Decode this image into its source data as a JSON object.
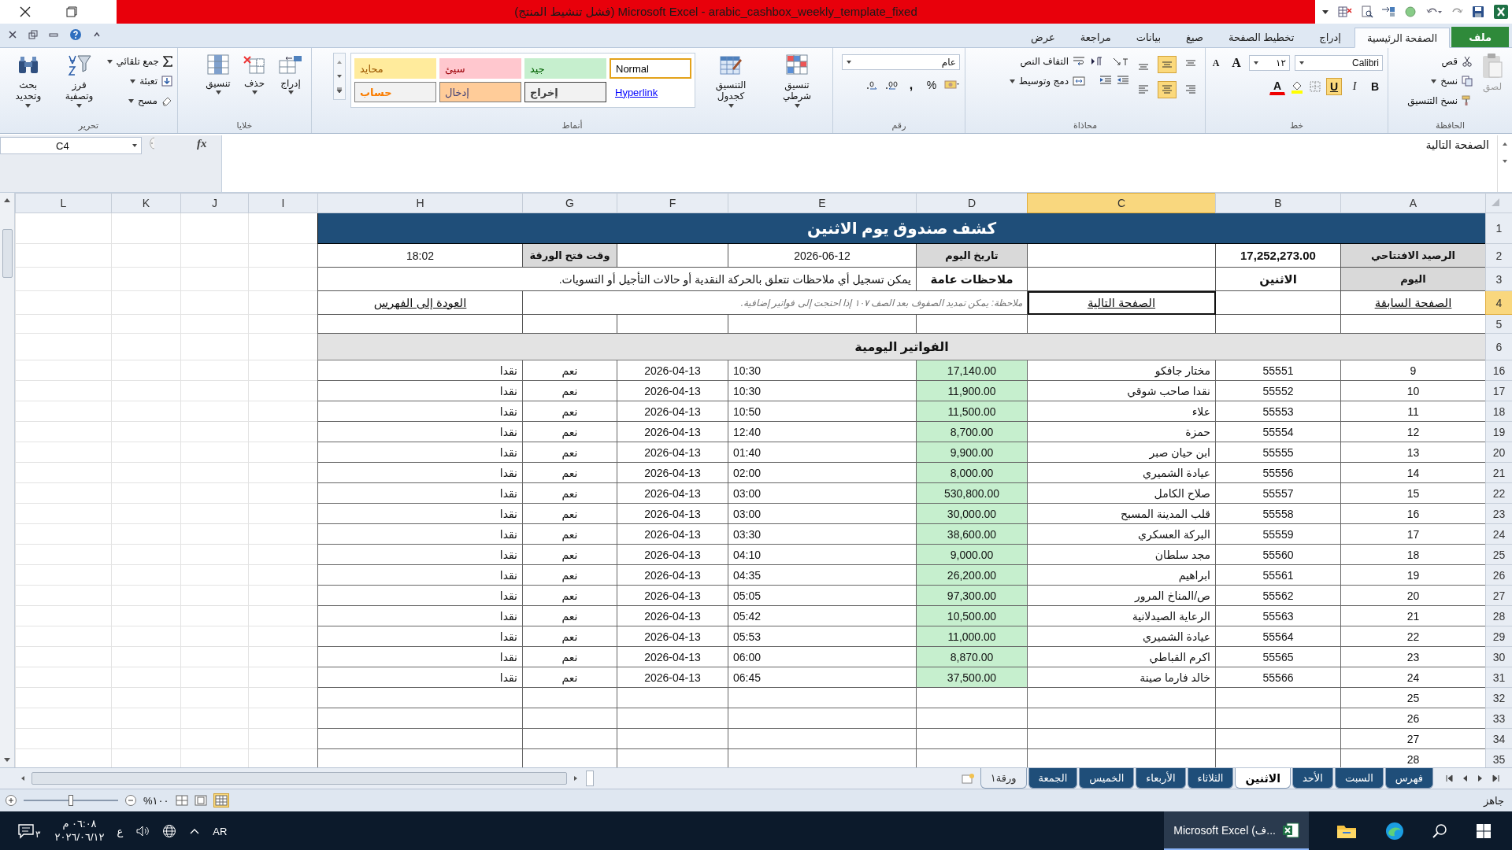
{
  "title_bar": {
    "title": "(فشل تنشيط المنتج) Microsoft Excel - arabic_cashbox_weekly_template_fixed"
  },
  "ribbon_tabs": [
    {
      "label": "ملف",
      "kind": "file",
      "selected": false
    },
    {
      "label": "الصفحة الرئيسية",
      "kind": "tab",
      "selected": true
    },
    {
      "label": "إدراج",
      "kind": "tab",
      "selected": false
    },
    {
      "label": "تخطيط الصفحة",
      "kind": "tab",
      "selected": false
    },
    {
      "label": "صيغ",
      "kind": "tab",
      "selected": false
    },
    {
      "label": "بيانات",
      "kind": "tab",
      "selected": false
    },
    {
      "label": "مراجعة",
      "kind": "tab",
      "selected": false
    },
    {
      "label": "عرض",
      "kind": "tab",
      "selected": false
    }
  ],
  "clipboard": {
    "label": "الحافظة",
    "paste": "لصق",
    "paste_disabled": true,
    "cut": "قص",
    "copy": "نسخ",
    "format_painter": "نسخ التنسيق"
  },
  "font": {
    "label": "خط",
    "family": "Calibri",
    "size": "١٢",
    "grow": "A",
    "shrink": "A",
    "font_color": "A",
    "buttons": [
      {
        "label": "B",
        "kind": "bold",
        "on": false
      },
      {
        "label": "I",
        "kind": "italic",
        "on": false
      },
      {
        "label": "U",
        "kind": "underline",
        "on": true
      }
    ]
  },
  "alignment": {
    "label": "محاذاة",
    "wrap_text": "التفاف النص",
    "merge_center": "دمج وتوسيط",
    "vertical": [
      {
        "kind": "top",
        "selected": false
      },
      {
        "kind": "middle",
        "selected": true
      },
      {
        "kind": "bottom",
        "selected": false
      }
    ],
    "horizontal": [
      {
        "kind": "right",
        "selected": false
      },
      {
        "kind": "center",
        "selected": true
      },
      {
        "kind": "left",
        "selected": false
      }
    ]
  },
  "number": {
    "label": "رقم",
    "format": "عام",
    "percent": "%",
    "comma": ","
  },
  "styles": {
    "label": "أنماط",
    "conditional": "تنسيق شرطي",
    "as_table": "التنسيق كجدول",
    "cell_styles": [
      {
        "label": "Normal",
        "kind": "normal",
        "selected": true
      },
      {
        "label": "جيد",
        "kind": "good",
        "selected": false
      },
      {
        "label": "سيئ",
        "kind": "bad",
        "selected": false
      },
      {
        "label": "محايد",
        "kind": "neutral",
        "selected": false
      },
      {
        "label": "Hyperlink",
        "kind": "hyperlink",
        "selected": false
      },
      {
        "label": "إخراج",
        "kind": "output",
        "selected": false
      },
      {
        "label": "إدخال",
        "kind": "input",
        "selected": false
      },
      {
        "label": "حساب",
        "kind": "calculation",
        "selected": false
      }
    ]
  },
  "cells": {
    "label": "خلايا",
    "insert": "إدراج",
    "delete": "حذف",
    "format": "تنسيق"
  },
  "editing": {
    "label": "تحرير",
    "autosum": "جمع تلقائي",
    "fill": "تعبئة",
    "clear": "مسح",
    "sort": "فرز وتصفية",
    "find": "بحث وتحديد"
  },
  "formula_bar": {
    "name_box": "C4",
    "function_label": "fx",
    "content": "الصفحة التالية"
  },
  "columns": [
    {
      "label": "A",
      "selected": false
    },
    {
      "label": "B",
      "selected": false
    },
    {
      "label": "C",
      "selected": true
    },
    {
      "label": "D",
      "selected": false
    },
    {
      "label": "E",
      "selected": false
    },
    {
      "label": "F",
      "selected": false
    },
    {
      "label": "G",
      "selected": false
    },
    {
      "label": "H",
      "selected": false
    },
    {
      "label": "I",
      "selected": false
    },
    {
      "label": "J",
      "selected": false
    },
    {
      "label": "K",
      "selected": false
    },
    {
      "label": "L",
      "selected": false
    }
  ],
  "rows": [
    {
      "number": "1",
      "kind": "title",
      "selected": false,
      "text": "كشف صندوق يوم الاثنين"
    },
    {
      "number": "2",
      "kind": "form",
      "selected": false,
      "cells": [
        {
          "kind": "label",
          "text": "الرصيد الافتتاحي"
        },
        {
          "kind": "strong",
          "text": "17,252,273.00"
        },
        {
          "kind": "empty"
        },
        {
          "kind": "label",
          "text": "تاريخ اليوم"
        },
        {
          "kind": "value",
          "text": "2026-06-12"
        },
        {
          "kind": "empty"
        },
        {
          "kind": "label",
          "text": "وقت فتح الورقة"
        },
        {
          "kind": "value",
          "text": "18:02"
        }
      ]
    },
    {
      "number": "3",
      "kind": "form",
      "selected": false,
      "cells": [
        {
          "kind": "label",
          "text": "اليوم"
        },
        {
          "kind": "strong",
          "text": "الاثنين"
        },
        {
          "kind": "empty"
        },
        {
          "kind": "strong",
          "text": "ملاحظات عامة"
        },
        {
          "kind": "text",
          "text": "يمكن تسجيل أي ملاحظات تتعلق بالحركة النقدية أو حالات التأجيل أو التسويات."
        }
      ]
    },
    {
      "number": "4",
      "kind": "form",
      "selected": true,
      "cells": [
        {
          "kind": "link",
          "text": "الصفحة السابقة"
        },
        {
          "kind": "empty"
        },
        {
          "kind": "link",
          "text": "الصفحة التالية"
        },
        {
          "kind": "note",
          "text": "ملاحظة: يمكن تمديد الصفوف بعد الصف ١٠٧ إذا احتجت إلى فواتير إضافية."
        },
        {
          "kind": "link",
          "text": "العودة إلى الفهرس"
        }
      ]
    },
    {
      "number": "5",
      "kind": "blank",
      "selected": false
    },
    {
      "number": "6",
      "kind": "section",
      "selected": false,
      "text": "الفواتير اليومية"
    },
    {
      "number": "16",
      "kind": "invoice",
      "selected": false,
      "values": [
        "9",
        "55551",
        "مختار جافكو",
        "17,140.00",
        "10:30",
        "2026-04-13",
        "نعم",
        "نقدا"
      ]
    },
    {
      "number": "17",
      "kind": "invoice",
      "selected": false,
      "values": [
        "10",
        "55552",
        "نقدا صاحب شوقي",
        "11,900.00",
        "10:30",
        "2026-04-13",
        "نعم",
        "نقدا"
      ]
    },
    {
      "number": "18",
      "kind": "invoice",
      "selected": false,
      "values": [
        "11",
        "55553",
        "علاء",
        "11,500.00",
        "10:50",
        "2026-04-13",
        "نعم",
        "نقدا"
      ]
    },
    {
      "number": "19",
      "kind": "invoice",
      "selected": false,
      "values": [
        "12",
        "55554",
        "حمزة",
        "8,700.00",
        "12:40",
        "2026-04-13",
        "نعم",
        "نقدا"
      ]
    },
    {
      "number": "20",
      "kind": "invoice",
      "selected": false,
      "values": [
        "13",
        "55555",
        "ابن حيان صبر",
        "9,900.00",
        "01:40",
        "2026-04-13",
        "نعم",
        "نقدا"
      ]
    },
    {
      "number": "21",
      "kind": "invoice",
      "selected": false,
      "values": [
        "14",
        "55556",
        "عيادة الشميري",
        "8,000.00",
        "02:00",
        "2026-04-13",
        "نعم",
        "نقدا"
      ]
    },
    {
      "number": "22",
      "kind": "invoice",
      "selected": false,
      "values": [
        "15",
        "55557",
        "صلاح الكامل",
        "530,800.00",
        "03:00",
        "2026-04-13",
        "نعم",
        "نقدا"
      ]
    },
    {
      "number": "23",
      "kind": "invoice",
      "selected": false,
      "values": [
        "16",
        "55558",
        "قلب المدينة المسبح",
        "30,000.00",
        "03:00",
        "2026-04-13",
        "نعم",
        "نقدا"
      ]
    },
    {
      "number": "24",
      "kind": "invoice",
      "selected": false,
      "values": [
        "17",
        "55559",
        "البركة العسكري",
        "38,600.00",
        "03:30",
        "2026-04-13",
        "نعم",
        "نقدا"
      ]
    },
    {
      "number": "25",
      "kind": "invoice",
      "selected": false,
      "values": [
        "18",
        "55560",
        "مجد سلطان",
        "9,000.00",
        "04:10",
        "2026-04-13",
        "نعم",
        "نقدا"
      ]
    },
    {
      "number": "26",
      "kind": "invoice",
      "selected": false,
      "values": [
        "19",
        "55561",
        "ابراهيم",
        "26,200.00",
        "04:35",
        "2026-04-13",
        "نعم",
        "نقدا"
      ]
    },
    {
      "number": "27",
      "kind": "invoice",
      "selected": false,
      "values": [
        "20",
        "55562",
        "ص/المناخ المرور",
        "97,300.00",
        "05:05",
        "2026-04-13",
        "نعم",
        "نقدا"
      ]
    },
    {
      "number": "28",
      "kind": "invoice",
      "selected": false,
      "values": [
        "21",
        "55563",
        "الرعاية الصيدلانية",
        "10,500.00",
        "05:42",
        "2026-04-13",
        "نعم",
        "نقدا"
      ]
    },
    {
      "number": "29",
      "kind": "invoice",
      "selected": false,
      "values": [
        "22",
        "55564",
        "عيادة الشميري",
        "11,000.00",
        "05:53",
        "2026-04-13",
        "نعم",
        "نقدا"
      ]
    },
    {
      "number": "30",
      "kind": "invoice",
      "selected": false,
      "values": [
        "23",
        "55565",
        "اكرم القباطي",
        "8,870.00",
        "06:00",
        "2026-04-13",
        "نعم",
        "نقدا"
      ]
    },
    {
      "number": "31",
      "kind": "invoice",
      "selected": false,
      "values": [
        "24",
        "55566",
        "خالد فارما صينة",
        "37,500.00",
        "06:45",
        "2026-04-13",
        "نعم",
        "نقدا"
      ]
    },
    {
      "number": "32",
      "kind": "invoice",
      "selected": false,
      "values": [
        "25"
      ]
    },
    {
      "number": "33",
      "kind": "invoice",
      "selected": false,
      "values": [
        "26"
      ]
    },
    {
      "number": "34",
      "kind": "invoice",
      "selected": false,
      "values": [
        "27"
      ]
    },
    {
      "number": "35",
      "kind": "invoice",
      "selected": false,
      "values": [
        "28"
      ]
    }
  ],
  "sheet_tabs": [
    {
      "label": "فهرس",
      "color": "#1f4e79",
      "selected": false
    },
    {
      "label": "السبت",
      "color": "#1f4e79",
      "selected": false
    },
    {
      "label": "الأحد",
      "color": "#1f4e79",
      "selected": false
    },
    {
      "label": "الاثنين",
      "selected": true
    },
    {
      "label": "الثلاثاء",
      "color": "#1f4e79",
      "selected": false
    },
    {
      "label": "الأربعاء",
      "color": "#1f4e79",
      "selected": false
    },
    {
      "label": "الخميس",
      "color": "#1f4e79",
      "selected": false
    },
    {
      "label": "الجمعة",
      "color": "#1f4e79",
      "selected": false
    },
    {
      "label": "ورقة١",
      "selected": false
    }
  ],
  "status_bar": {
    "status": "جاهز",
    "zoom": {
      "label": "%١٠٠",
      "level": 0.5
    }
  },
  "taskbar": {
    "app": "Microsoft Excel (ف...",
    "language": "AR",
    "keyboard": "ع",
    "time": "٠٦:٠٨ م",
    "date": "٢٠٢٦/٠٦/١٢",
    "notifications": "٣"
  }
}
